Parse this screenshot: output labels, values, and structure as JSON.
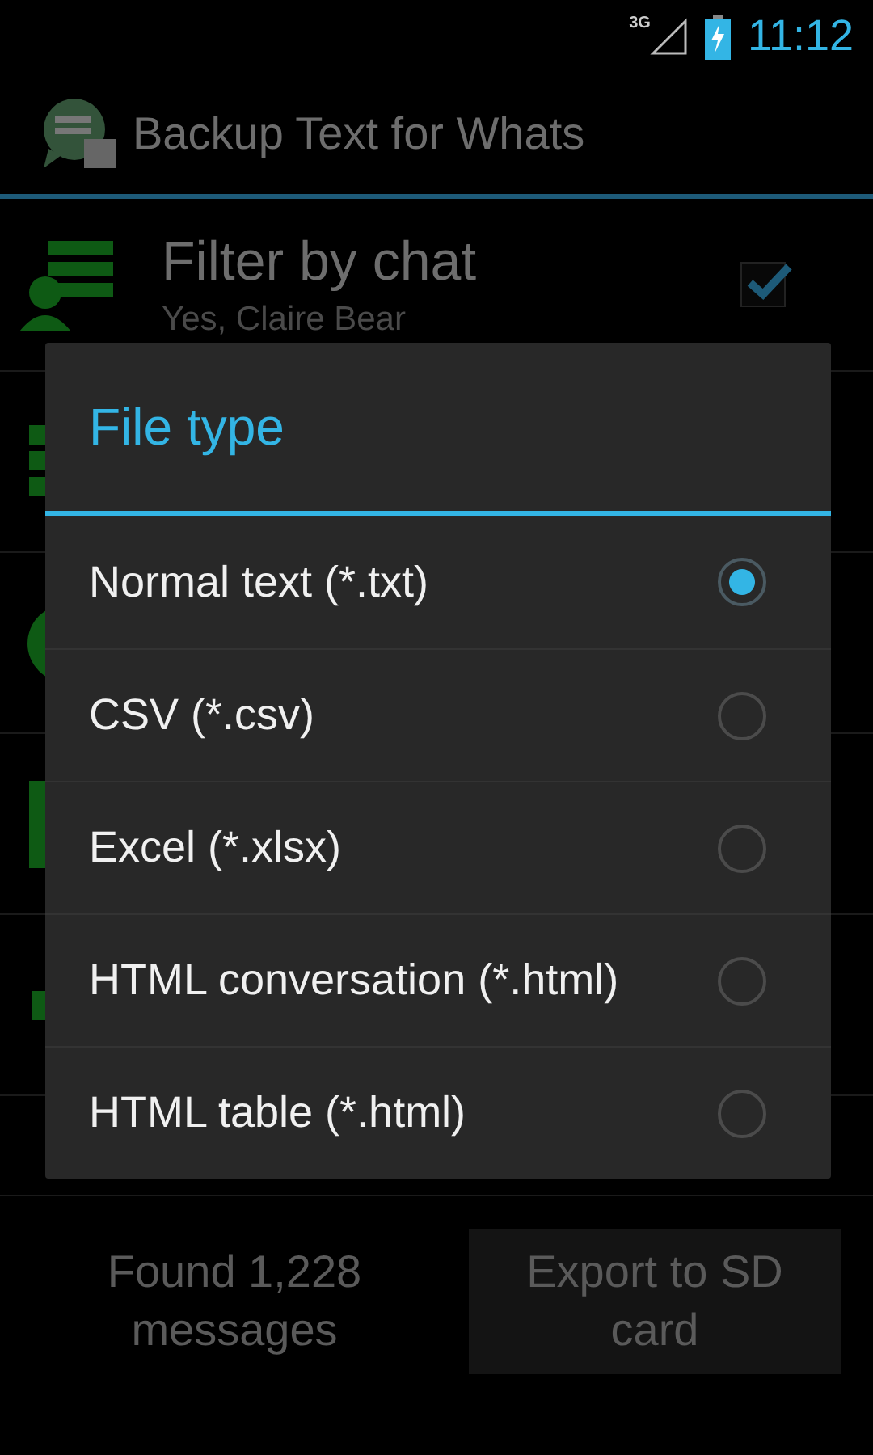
{
  "status_bar": {
    "network": "3G",
    "time": "11:12"
  },
  "action_bar": {
    "title": "Backup Text for Whats"
  },
  "settings": [
    {
      "title": "Filter by chat",
      "summary": "Yes, Claire Bear",
      "checked": true
    }
  ],
  "footer": {
    "count_text": "Found 1,228 messages",
    "export_button": "Export to SD card"
  },
  "dialog": {
    "title": "File type",
    "options": [
      {
        "label": "Normal text (*.txt)",
        "selected": true
      },
      {
        "label": "CSV (*.csv)",
        "selected": false
      },
      {
        "label": "Excel (*.xlsx)",
        "selected": false
      },
      {
        "label": "HTML conversation (*.html)",
        "selected": false
      },
      {
        "label": "HTML table (*.html)",
        "selected": false
      }
    ]
  }
}
